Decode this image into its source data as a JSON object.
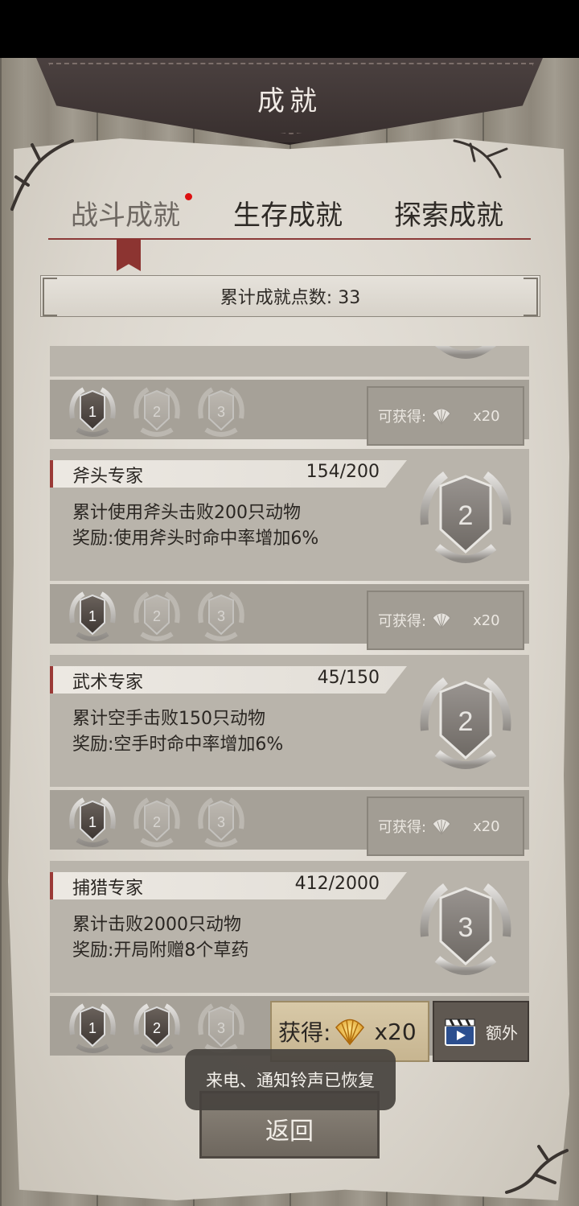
{
  "header": {
    "title": "成就"
  },
  "tabs": [
    {
      "label": "战斗成就",
      "active": true,
      "has_notification": true
    },
    {
      "label": "生存成就",
      "active": false
    },
    {
      "label": "探索成就",
      "active": false
    }
  ],
  "points": {
    "label": "累计成就点数: 33"
  },
  "achievements": [
    {
      "name": "",
      "progress": "",
      "desc1": "",
      "desc2": "",
      "medals": [
        "1",
        "2",
        "3"
      ],
      "medals_earned": 1,
      "reward": {
        "label": "可获得:",
        "count": "x20",
        "claimable": false
      }
    },
    {
      "name": "斧头专家",
      "progress": "154/200",
      "desc1": "累计使用斧头击败200只动物",
      "desc2": "奖励:使用斧头时命中率增加6%",
      "badge_level": "2",
      "medals": [
        "1",
        "2",
        "3"
      ],
      "medals_earned": 1,
      "reward": {
        "label": "可获得:",
        "count": "x20",
        "claimable": false
      }
    },
    {
      "name": "武术专家",
      "progress": "45/150",
      "desc1": "累计空手击败150只动物",
      "desc2": "奖励:空手时命中率增加6%",
      "badge_level": "2",
      "medals": [
        "1",
        "2",
        "3"
      ],
      "medals_earned": 1,
      "reward": {
        "label": "可获得:",
        "count": "x20",
        "claimable": false
      }
    },
    {
      "name": "捕猎专家",
      "progress": "412/2000",
      "desc1": "累计击败2000只动物",
      "desc2": "奖励:开局附赠8个草药",
      "badge_level": "3",
      "medals": [
        "1",
        "2",
        "3"
      ],
      "medals_earned": 2,
      "reward": {
        "label": "获得:",
        "count": "x20",
        "claimable": true,
        "extra_label": "额外"
      }
    }
  ],
  "back_button": {
    "label": "返回"
  },
  "toast": {
    "text": "来电、通知铃声已恢复"
  },
  "colors": {
    "accent_red": "#9b3a37",
    "leather": "#3f3635",
    "gold": "#d8c9a8"
  }
}
